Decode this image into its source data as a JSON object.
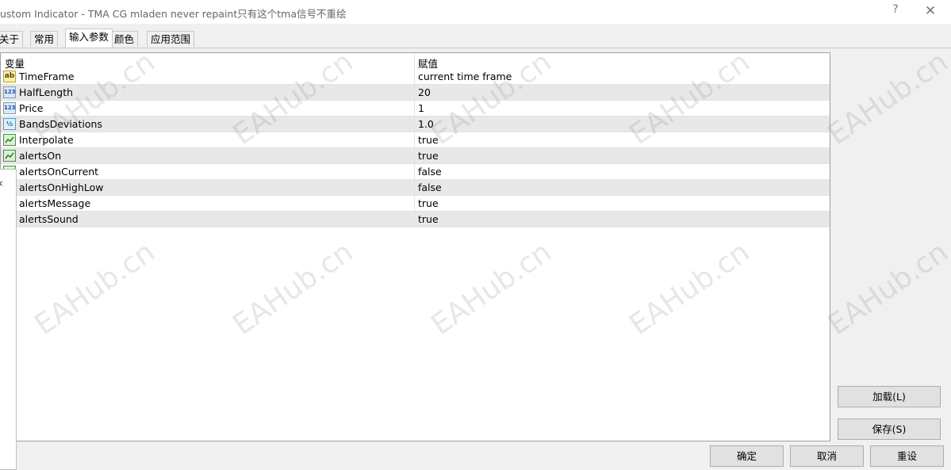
{
  "window": {
    "title": "ustom Indicator - TMA CG mladen never repaint只有这个tma信号不重绘",
    "help_label": "?",
    "close_label": "✕"
  },
  "tabs": [
    {
      "label": "关于"
    },
    {
      "label": "常用"
    },
    {
      "label": "输入参数"
    },
    {
      "label": "颜色"
    },
    {
      "label": "应用范围"
    }
  ],
  "table": {
    "columns": [
      "变量",
      "赋值"
    ],
    "rows": [
      {
        "name": "TimeFrame",
        "value": "current time frame",
        "icon": "ab"
      },
      {
        "name": "HalfLength",
        "value": "20",
        "icon": "123"
      },
      {
        "name": "Price",
        "value": "1",
        "icon": "123"
      },
      {
        "name": "BandsDeviations",
        "value": "1.0",
        "icon": "½"
      },
      {
        "name": "Interpolate",
        "value": "true",
        "icon": "bool-chart"
      },
      {
        "name": "alertsOn",
        "value": "true",
        "icon": "bool-chart"
      },
      {
        "name": "alertsOnCurrent",
        "value": "false",
        "icon": "bool-chart"
      },
      {
        "name": "alertsOnHighLow",
        "value": "false",
        "icon": "bool-chart"
      },
      {
        "name": "alertsMessage",
        "value": "true",
        "icon": "bool-chart"
      },
      {
        "name": "alertsSound",
        "value": "true",
        "icon": "bool-chart"
      }
    ]
  },
  "buttons": {
    "load": "加载(L)",
    "save": "保存(S)",
    "ok": "确定",
    "cancel": "取消",
    "reset": "重设"
  },
  "flyout": {
    "chevron": "‹"
  },
  "watermark": "EAHub.cn"
}
